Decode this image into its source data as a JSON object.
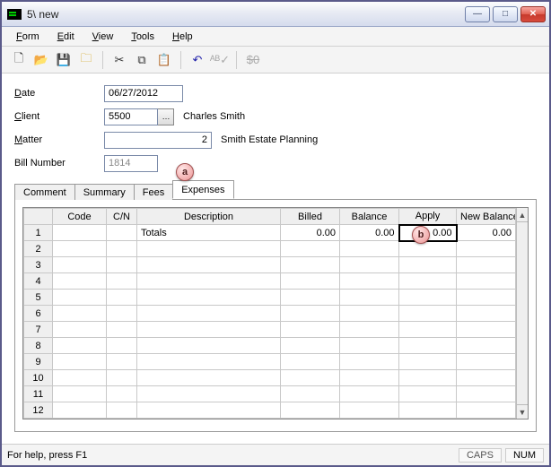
{
  "window": {
    "title": "5\\ new"
  },
  "menu": {
    "form": "Form",
    "edit": "Edit",
    "view": "View",
    "tools": "Tools",
    "help": "Help"
  },
  "form": {
    "date_label": "Date",
    "date": "06/27/2012",
    "client_label": "Client",
    "client_code": "5500",
    "client_name": "Charles Smith",
    "matter_label": "Matter",
    "matter_code": "2",
    "matter_name": "Smith Estate Planning",
    "billno_label": "Bill Number",
    "billno": "1814"
  },
  "tabs": {
    "comment": "Comment",
    "summary": "Summary",
    "fees": "Fees",
    "expenses": "Expenses",
    "active": "expenses"
  },
  "grid": {
    "headers": {
      "code": "Code",
      "cn": "C/N",
      "desc": "Description",
      "billed": "Billed",
      "balance": "Balance",
      "apply": "Apply",
      "newbal": "New Balance"
    },
    "rows": [
      {
        "n": 1,
        "code": "",
        "cn": "",
        "desc": "Totals",
        "billed": "0.00",
        "balance": "0.00",
        "apply": "0.00",
        "newbal": "0.00"
      },
      {
        "n": 2
      },
      {
        "n": 3
      },
      {
        "n": 4
      },
      {
        "n": 5
      },
      {
        "n": 6
      },
      {
        "n": 7
      },
      {
        "n": 8
      },
      {
        "n": 9
      },
      {
        "n": 10
      },
      {
        "n": 11
      },
      {
        "n": 12
      }
    ]
  },
  "callouts": {
    "a": "a",
    "b": "b"
  },
  "status": {
    "help": "For help, press F1",
    "caps": "CAPS",
    "num": "NUM"
  }
}
